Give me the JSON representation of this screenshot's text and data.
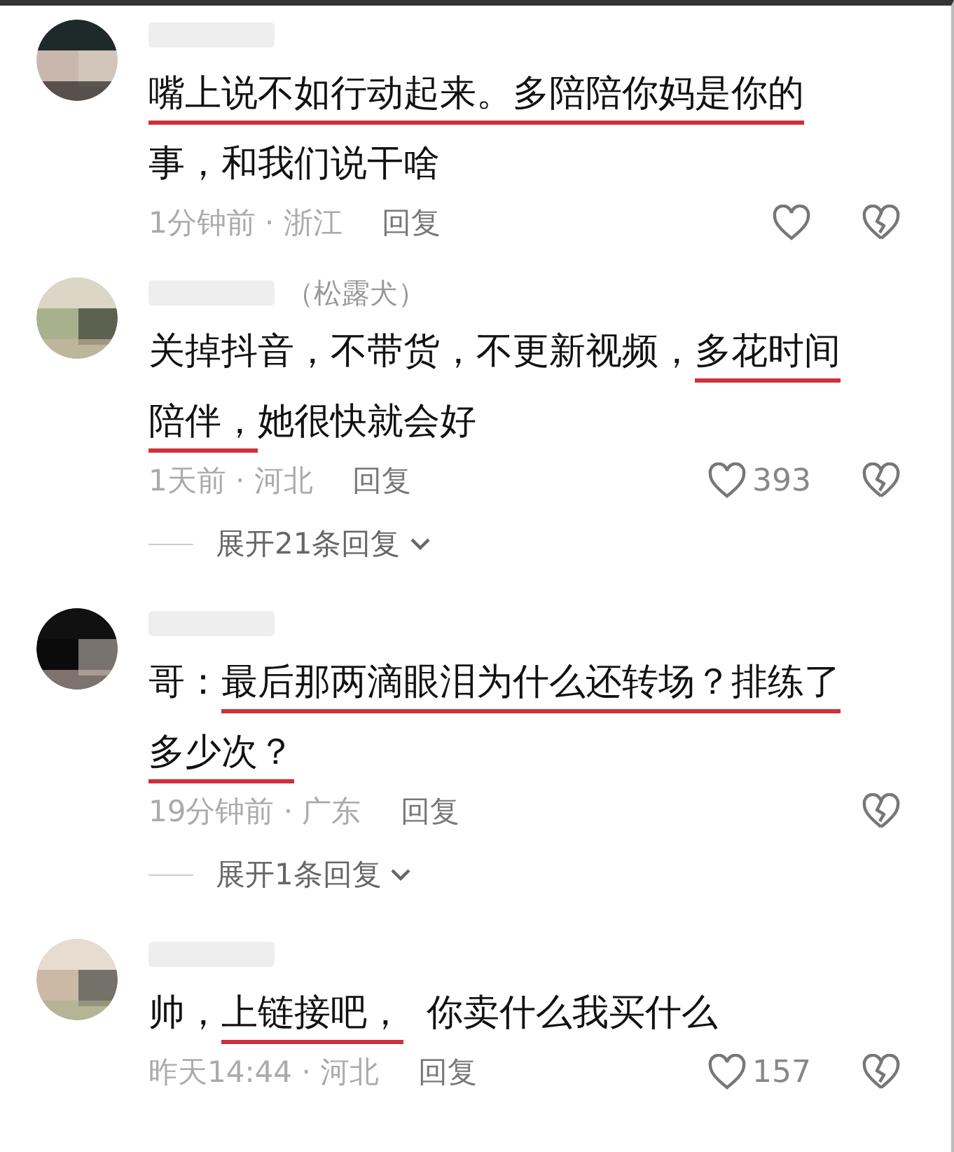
{
  "comments": [
    {
      "lines": [
        [
          {
            "t": "嘴上说不如行动起来。多陪陪你妈是你的",
            "underlined": true
          }
        ],
        [
          {
            "t": "事，和我们说干啥",
            "underlined": false
          }
        ]
      ],
      "meta": "1分钟前 · 浙江",
      "reply": "回复",
      "like": {
        "shown": true
      }
    },
    {
      "username": "（松露犬）",
      "lines": [
        [
          {
            "t": "关掉抖音，不带货，不更新视频，",
            "underlined": false
          },
          {
            "t": "多花时间",
            "underlined": true
          }
        ],
        [
          {
            "t": "陪伴，",
            "underlined": true
          },
          {
            "t": "她很快就会好",
            "underlined": false
          }
        ]
      ],
      "meta": "1天前 · 河北",
      "reply": "回复",
      "like": {
        "shown": true,
        "count": "393"
      },
      "expand": "展开21条回复"
    },
    {
      "lines": [
        [
          {
            "t": "哥：",
            "underlined": false
          },
          {
            "t": "最后那两滴眼泪为什么还转场？排练了",
            "underlined": true
          }
        ],
        [
          {
            "t": "多少次？",
            "underlined": true
          }
        ]
      ],
      "meta": "19分钟前 · 广东",
      "reply": "回复",
      "expand": "展开1条回复"
    },
    {
      "lines": [
        [
          {
            "t": "帅，",
            "underlined": false
          },
          {
            "t": "上链接吧，",
            "underlined": true
          },
          {
            "t": "  你卖什么我买什么",
            "underlined": false
          }
        ]
      ],
      "meta": "昨天14:44 · 河北",
      "reply": "回复",
      "like": {
        "shown": true,
        "count": "157"
      }
    }
  ]
}
